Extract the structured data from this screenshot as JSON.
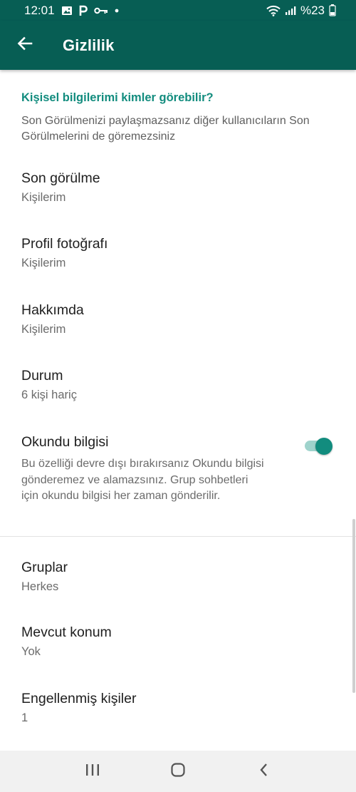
{
  "status_bar": {
    "time": "12:01",
    "left_icons": [
      "gallery-icon",
      "parking-icon",
      "key-icon",
      "dot-icon"
    ],
    "right_icons": [
      "wifi-icon",
      "signal-icon"
    ],
    "battery_text": "%23"
  },
  "header": {
    "title": "Gizlilik",
    "back_icon": "arrow-back-icon",
    "background": "#075e54"
  },
  "section": {
    "title": "Kişisel bilgilerimi kimler görebilir?",
    "description": "Son Görülmenizi paylaşmazsanız diğer kullanıcıların Son Görülmelerini de göremezsiniz"
  },
  "items": {
    "last_seen": {
      "title": "Son görülme",
      "value": "Kişilerim"
    },
    "profile_photo": {
      "title": "Profil fotoğrafı",
      "value": "Kişilerim"
    },
    "about": {
      "title": "Hakkımda",
      "value": "Kişilerim"
    },
    "status": {
      "title": "Durum",
      "value": "6 kişi hariç"
    },
    "read_receipts": {
      "title": "Okundu bilgisi",
      "description": "Bu özelliği devre dışı bırakırsanız Okundu bilgisi gönderemez ve alamazsınız. Grup sohbetleri için okundu bilgisi her zaman gönderilir.",
      "enabled": true
    },
    "groups": {
      "title": "Gruplar",
      "value": "Herkes"
    },
    "live_location": {
      "title": "Mevcut konum",
      "value": "Yok"
    },
    "blocked": {
      "title": "Engellenmiş kişiler",
      "value": "1"
    }
  },
  "nav_bar": {
    "icons": [
      "recent-apps-icon",
      "home-icon",
      "back-nav-icon"
    ]
  },
  "colors": {
    "accent": "#128c7e",
    "toolbar": "#075e54",
    "switch_track": "#9fd3cc"
  }
}
